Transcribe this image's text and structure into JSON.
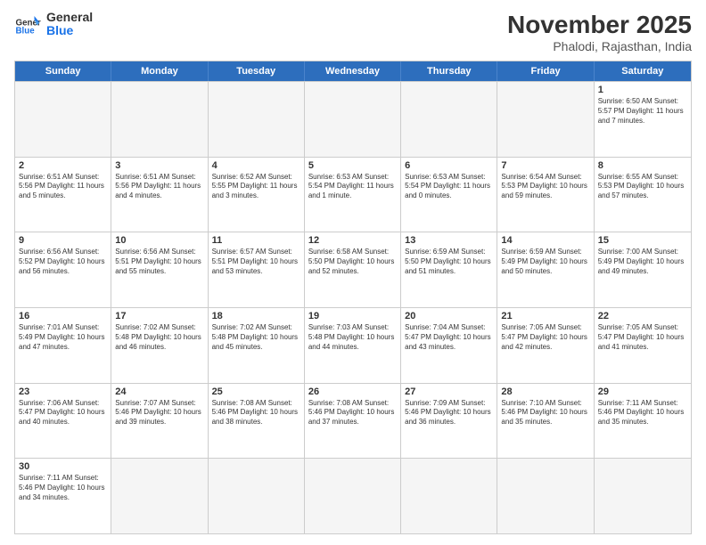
{
  "header": {
    "logo_general": "General",
    "logo_blue": "Blue",
    "month_title": "November 2025",
    "location": "Phalodi, Rajasthan, India"
  },
  "weekdays": [
    "Sunday",
    "Monday",
    "Tuesday",
    "Wednesday",
    "Thursday",
    "Friday",
    "Saturday"
  ],
  "rows": [
    [
      {
        "day": "",
        "info": "",
        "empty": true
      },
      {
        "day": "",
        "info": "",
        "empty": true
      },
      {
        "day": "",
        "info": "",
        "empty": true
      },
      {
        "day": "",
        "info": "",
        "empty": true
      },
      {
        "day": "",
        "info": "",
        "empty": true
      },
      {
        "day": "",
        "info": "",
        "empty": true
      },
      {
        "day": "1",
        "info": "Sunrise: 6:50 AM\nSunset: 5:57 PM\nDaylight: 11 hours and 7 minutes."
      }
    ],
    [
      {
        "day": "2",
        "info": "Sunrise: 6:51 AM\nSunset: 5:56 PM\nDaylight: 11 hours and 5 minutes."
      },
      {
        "day": "3",
        "info": "Sunrise: 6:51 AM\nSunset: 5:56 PM\nDaylight: 11 hours and 4 minutes."
      },
      {
        "day": "4",
        "info": "Sunrise: 6:52 AM\nSunset: 5:55 PM\nDaylight: 11 hours and 3 minutes."
      },
      {
        "day": "5",
        "info": "Sunrise: 6:53 AM\nSunset: 5:54 PM\nDaylight: 11 hours and 1 minute."
      },
      {
        "day": "6",
        "info": "Sunrise: 6:53 AM\nSunset: 5:54 PM\nDaylight: 11 hours and 0 minutes."
      },
      {
        "day": "7",
        "info": "Sunrise: 6:54 AM\nSunset: 5:53 PM\nDaylight: 10 hours and 59 minutes."
      },
      {
        "day": "8",
        "info": "Sunrise: 6:55 AM\nSunset: 5:53 PM\nDaylight: 10 hours and 57 minutes."
      }
    ],
    [
      {
        "day": "9",
        "info": "Sunrise: 6:56 AM\nSunset: 5:52 PM\nDaylight: 10 hours and 56 minutes."
      },
      {
        "day": "10",
        "info": "Sunrise: 6:56 AM\nSunset: 5:51 PM\nDaylight: 10 hours and 55 minutes."
      },
      {
        "day": "11",
        "info": "Sunrise: 6:57 AM\nSunset: 5:51 PM\nDaylight: 10 hours and 53 minutes."
      },
      {
        "day": "12",
        "info": "Sunrise: 6:58 AM\nSunset: 5:50 PM\nDaylight: 10 hours and 52 minutes."
      },
      {
        "day": "13",
        "info": "Sunrise: 6:59 AM\nSunset: 5:50 PM\nDaylight: 10 hours and 51 minutes."
      },
      {
        "day": "14",
        "info": "Sunrise: 6:59 AM\nSunset: 5:49 PM\nDaylight: 10 hours and 50 minutes."
      },
      {
        "day": "15",
        "info": "Sunrise: 7:00 AM\nSunset: 5:49 PM\nDaylight: 10 hours and 49 minutes."
      }
    ],
    [
      {
        "day": "16",
        "info": "Sunrise: 7:01 AM\nSunset: 5:49 PM\nDaylight: 10 hours and 47 minutes."
      },
      {
        "day": "17",
        "info": "Sunrise: 7:02 AM\nSunset: 5:48 PM\nDaylight: 10 hours and 46 minutes."
      },
      {
        "day": "18",
        "info": "Sunrise: 7:02 AM\nSunset: 5:48 PM\nDaylight: 10 hours and 45 minutes."
      },
      {
        "day": "19",
        "info": "Sunrise: 7:03 AM\nSunset: 5:48 PM\nDaylight: 10 hours and 44 minutes."
      },
      {
        "day": "20",
        "info": "Sunrise: 7:04 AM\nSunset: 5:47 PM\nDaylight: 10 hours and 43 minutes."
      },
      {
        "day": "21",
        "info": "Sunrise: 7:05 AM\nSunset: 5:47 PM\nDaylight: 10 hours and 42 minutes."
      },
      {
        "day": "22",
        "info": "Sunrise: 7:05 AM\nSunset: 5:47 PM\nDaylight: 10 hours and 41 minutes."
      }
    ],
    [
      {
        "day": "23",
        "info": "Sunrise: 7:06 AM\nSunset: 5:47 PM\nDaylight: 10 hours and 40 minutes."
      },
      {
        "day": "24",
        "info": "Sunrise: 7:07 AM\nSunset: 5:46 PM\nDaylight: 10 hours and 39 minutes."
      },
      {
        "day": "25",
        "info": "Sunrise: 7:08 AM\nSunset: 5:46 PM\nDaylight: 10 hours and 38 minutes."
      },
      {
        "day": "26",
        "info": "Sunrise: 7:08 AM\nSunset: 5:46 PM\nDaylight: 10 hours and 37 minutes."
      },
      {
        "day": "27",
        "info": "Sunrise: 7:09 AM\nSunset: 5:46 PM\nDaylight: 10 hours and 36 minutes."
      },
      {
        "day": "28",
        "info": "Sunrise: 7:10 AM\nSunset: 5:46 PM\nDaylight: 10 hours and 35 minutes."
      },
      {
        "day": "29",
        "info": "Sunrise: 7:11 AM\nSunset: 5:46 PM\nDaylight: 10 hours and 35 minutes."
      }
    ],
    [
      {
        "day": "30",
        "info": "Sunrise: 7:11 AM\nSunset: 5:46 PM\nDaylight: 10 hours and 34 minutes."
      },
      {
        "day": "",
        "info": "",
        "empty": true
      },
      {
        "day": "",
        "info": "",
        "empty": true
      },
      {
        "day": "",
        "info": "",
        "empty": true
      },
      {
        "day": "",
        "info": "",
        "empty": true
      },
      {
        "day": "",
        "info": "",
        "empty": true
      },
      {
        "day": "",
        "info": "",
        "empty": true
      }
    ]
  ]
}
